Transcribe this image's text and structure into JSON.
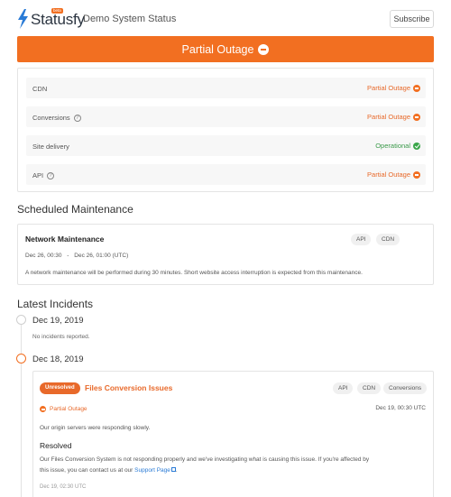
{
  "header": {
    "logo_text": "Statusfy",
    "beta_label": "beta",
    "page_title": "Demo System Status",
    "subscribe_label": "Subscribe"
  },
  "banner": {
    "label": "Partial Outage"
  },
  "components": [
    {
      "name": "CDN",
      "has_help": false,
      "status": "Partial Outage",
      "status_type": "partial"
    },
    {
      "name": "Conversions",
      "has_help": true,
      "status": "Partial Outage",
      "status_type": "partial"
    },
    {
      "name": "Site delivery",
      "has_help": false,
      "status": "Operational",
      "status_type": "operational"
    },
    {
      "name": "API",
      "has_help": true,
      "status": "Partial Outage",
      "status_type": "partial"
    }
  ],
  "maintenance": {
    "section_title": "Scheduled Maintenance",
    "title": "Network Maintenance",
    "tags": [
      "API",
      "CDN"
    ],
    "start": "Dec 26, 00:30",
    "separator": "-",
    "end": "Dec 26, 01:00 (UTC)",
    "description": "A network maintenance will be performed during 30 minutes. Short website access interruption is expected from this maintenance."
  },
  "incidents": {
    "section_title": "Latest Incidents",
    "days": [
      {
        "date": "Dec 19, 2019",
        "note": "No incidents reported."
      },
      {
        "date": "Dec 18, 2019"
      }
    ],
    "incident": {
      "badge": "Unresolved",
      "title": "Files Conversion Issues",
      "tags": [
        "API",
        "CDN",
        "Conversions"
      ],
      "status": "Partial Outage",
      "time": "Dec 19, 00:30 UTC",
      "text": "Our origin servers were responding slowly.",
      "update_title": "Resolved",
      "update_text_1": "Our Files Conversion System is not responding properly and we've investigating what is causing this issue. If you're affected by",
      "update_text_2": "this issue, you can contact us at our ",
      "support_link": "Support Page",
      "update_text_3": ".",
      "update_time": "Dec 19, 02:30 UTC"
    }
  },
  "colors": {
    "accent": "#f26f21",
    "partial": "#e8692a",
    "operational": "#3b9a4a",
    "link": "#2a7bd6"
  },
  "icons": {
    "logo": "lightning-bolt-icon",
    "partial": "minus-circle-icon",
    "operational": "check-circle-icon",
    "help": "question-circle-icon",
    "external": "external-link-icon"
  }
}
